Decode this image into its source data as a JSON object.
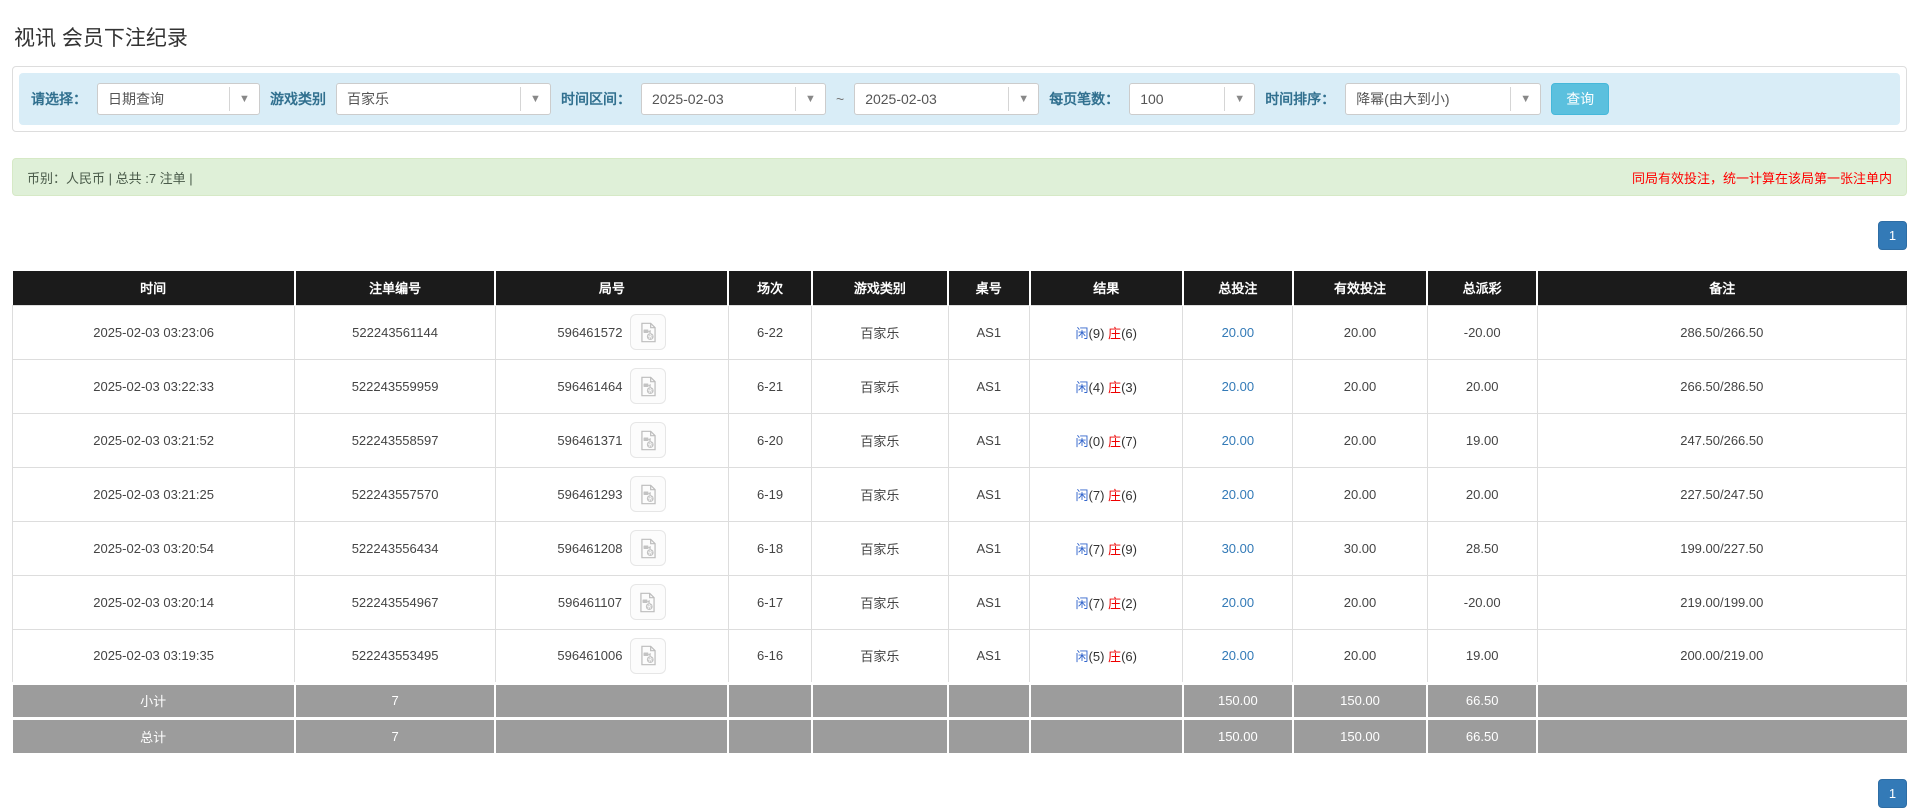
{
  "page": {
    "title": "视讯 会员下注纪录"
  },
  "icons": {
    "dropdown_arrow": "▼",
    "video_replay": "video-file-icon"
  },
  "filters": {
    "select_label": "请选择：",
    "select_value": "日期查询",
    "game_label": "游戏类别",
    "game_value": "百家乐",
    "range_label": "时间区间：",
    "date_from": "2025-02-03",
    "range_separator": "~",
    "date_to": "2025-02-03",
    "per_page_label": "每页笔数：",
    "per_page_value": "100",
    "sort_label": "时间排序：",
    "sort_value": "降幂(由大到小)",
    "search_button": "查询"
  },
  "summary": {
    "left": "币别：人民币 | 总共 :7 注单 |",
    "right": "同局有效投注，统一计算在该局第一张注单内"
  },
  "pagination": {
    "page": "1"
  },
  "table": {
    "headers": [
      "时间",
      "注单编号",
      "局号",
      "场次",
      "游戏类别",
      "桌号",
      "结果",
      "总投注",
      "有效投注",
      "总派彩",
      "备注"
    ],
    "result_labels": {
      "player": "闲",
      "banker": "庄"
    },
    "rows": [
      {
        "time": "2025-02-03 03:23:06",
        "bet_id": "522243561144",
        "round_id": "596461572",
        "session": "6-22",
        "game": "百家乐",
        "table_no": "AS1",
        "player_score": "(9)",
        "banker_score": "(6)",
        "total_bet": "20.00",
        "valid_bet": "20.00",
        "payout": "-20.00",
        "remark": "286.50/266.50"
      },
      {
        "time": "2025-02-03 03:22:33",
        "bet_id": "522243559959",
        "round_id": "596461464",
        "session": "6-21",
        "game": "百家乐",
        "table_no": "AS1",
        "player_score": "(4)",
        "banker_score": "(3)",
        "total_bet": "20.00",
        "valid_bet": "20.00",
        "payout": "20.00",
        "remark": "266.50/286.50"
      },
      {
        "time": "2025-02-03 03:21:52",
        "bet_id": "522243558597",
        "round_id": "596461371",
        "session": "6-20",
        "game": "百家乐",
        "table_no": "AS1",
        "player_score": "(0)",
        "banker_score": "(7)",
        "total_bet": "20.00",
        "valid_bet": "20.00",
        "payout": "19.00",
        "remark": "247.50/266.50"
      },
      {
        "time": "2025-02-03 03:21:25",
        "bet_id": "522243557570",
        "round_id": "596461293",
        "session": "6-19",
        "game": "百家乐",
        "table_no": "AS1",
        "player_score": "(7)",
        "banker_score": "(6)",
        "total_bet": "20.00",
        "valid_bet": "20.00",
        "payout": "20.00",
        "remark": "227.50/247.50"
      },
      {
        "time": "2025-02-03 03:20:54",
        "bet_id": "522243556434",
        "round_id": "596461208",
        "session": "6-18",
        "game": "百家乐",
        "table_no": "AS1",
        "player_score": "(7)",
        "banker_score": "(9)",
        "total_bet": "30.00",
        "valid_bet": "30.00",
        "payout": "28.50",
        "remark": "199.00/227.50"
      },
      {
        "time": "2025-02-03 03:20:14",
        "bet_id": "522243554967",
        "round_id": "596461107",
        "session": "6-17",
        "game": "百家乐",
        "table_no": "AS1",
        "player_score": "(7)",
        "banker_score": "(2)",
        "total_bet": "20.00",
        "valid_bet": "20.00",
        "payout": "-20.00",
        "remark": "219.00/199.00"
      },
      {
        "time": "2025-02-03 03:19:35",
        "bet_id": "522243553495",
        "round_id": "596461006",
        "session": "6-16",
        "game": "百家乐",
        "table_no": "AS1",
        "player_score": "(5)",
        "banker_score": "(6)",
        "total_bet": "20.00",
        "valid_bet": "20.00",
        "payout": "19.00",
        "remark": "200.00/219.00"
      }
    ],
    "footer": [
      {
        "label": "小计",
        "count": "7",
        "total_bet": "150.00",
        "valid_bet": "150.00",
        "payout": "66.50"
      },
      {
        "label": "总计",
        "count": "7",
        "total_bet": "150.00",
        "valid_bet": "150.00",
        "payout": "66.50"
      }
    ]
  },
  "colors": {
    "header_bg": "#1b1b1b",
    "footer_bg": "#9c9c9c",
    "filter_panel_bg": "#d9edf7",
    "summary_bg": "#dff0d8",
    "search_button_bg": "#5bc0de",
    "pagination_blue": "#337ab7",
    "link_blue": "#337ab7",
    "player_blue": "#3366cc",
    "banker_red": "#ee0000",
    "negative_red": "#ee0000",
    "notice_red": "#ff0000"
  }
}
